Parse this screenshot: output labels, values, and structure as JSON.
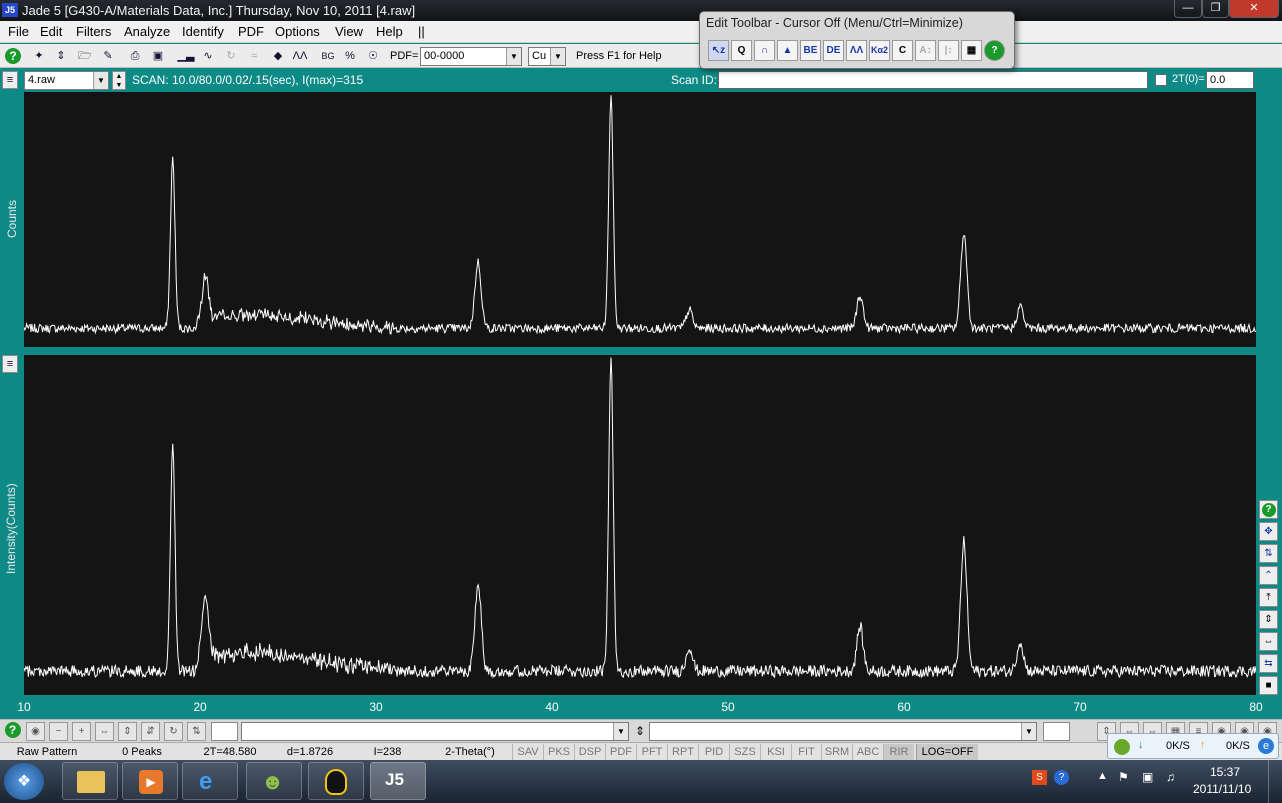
{
  "window": {
    "title": "Jade 5 [G430-A/Materials Data, Inc.] Thursday, Nov 10, 2011 [4.raw]",
    "app_icon": "jade-logo-icon"
  },
  "menu": [
    "File",
    "Edit",
    "Filters",
    "Analyze",
    "Identify",
    "PDF",
    "Options",
    "View",
    "Help",
    "||"
  ],
  "toolbar": {
    "pdf_label": "PDF=",
    "pdf_value": "00-0000",
    "anode": "Cu",
    "help_hint": "Press F1 for Help"
  },
  "edit_toolbar": {
    "title": "Edit Toolbar - Cursor Off (Menu/Ctrl=Minimize)",
    "buttons": [
      "↖z",
      "Q",
      "∩",
      "▲",
      "BE",
      "DE",
      "ΛΛ",
      "Kα2",
      "C",
      "A↕",
      "|↕",
      "▦",
      "?"
    ]
  },
  "scan_bar": {
    "file": "4.raw",
    "scan_info": "SCAN: 10.0/80.0/0.02/.15(sec), I(max)=315",
    "scan_id_label": "Scan ID:",
    "scan_id_value": "",
    "two_theta_label": "2T(0)=",
    "two_theta_value": "0.0"
  },
  "chart_data": [
    {
      "type": "line",
      "ylabel": "Counts",
      "xlim": [
        10,
        80
      ],
      "series": [
        {
          "name": "",
          "peaks": [
            [
              18.45,
              230
            ],
            [
              20.3,
              60
            ],
            [
              35.8,
              90
            ],
            [
              43.35,
              315
            ],
            [
              47.8,
              25
            ],
            [
              57.5,
              45
            ],
            [
              63.4,
              130
            ],
            [
              66.6,
              30
            ]
          ]
        }
      ]
    },
    {
      "type": "line",
      "ylabel": "Intensity(Counts)",
      "xlabel": "",
      "xlim": [
        10,
        80
      ],
      "x_ticks": [
        "10",
        "20",
        "30",
        "40",
        "50",
        "60",
        "70",
        "80"
      ],
      "series": [
        {
          "name": "",
          "peaks": [
            [
              18.45,
              230
            ],
            [
              20.3,
              60
            ],
            [
              35.8,
              90
            ],
            [
              43.35,
              315
            ],
            [
              47.8,
              25
            ],
            [
              57.5,
              45
            ],
            [
              63.4,
              130
            ],
            [
              66.6,
              30
            ]
          ]
        }
      ]
    }
  ],
  "status": {
    "mode": "Raw Pattern",
    "peaks": "0 Peaks",
    "two_theta": "2T=48.580",
    "d": "d=1.8726",
    "intensity": "I=238",
    "axis": "2-Theta(°)",
    "flags": [
      "SAV",
      "PKS",
      "DSP",
      "PDF",
      "PFT",
      "RPT",
      "PID",
      "SZS",
      "KSI",
      "FIT",
      "SRM",
      "ABC",
      "RIR"
    ],
    "log": "LOG=OFF"
  },
  "network": {
    "down": "0K/S",
    "up": "0K/S"
  },
  "taskbar": {
    "time": "15:37",
    "date": "2011/11/10"
  }
}
